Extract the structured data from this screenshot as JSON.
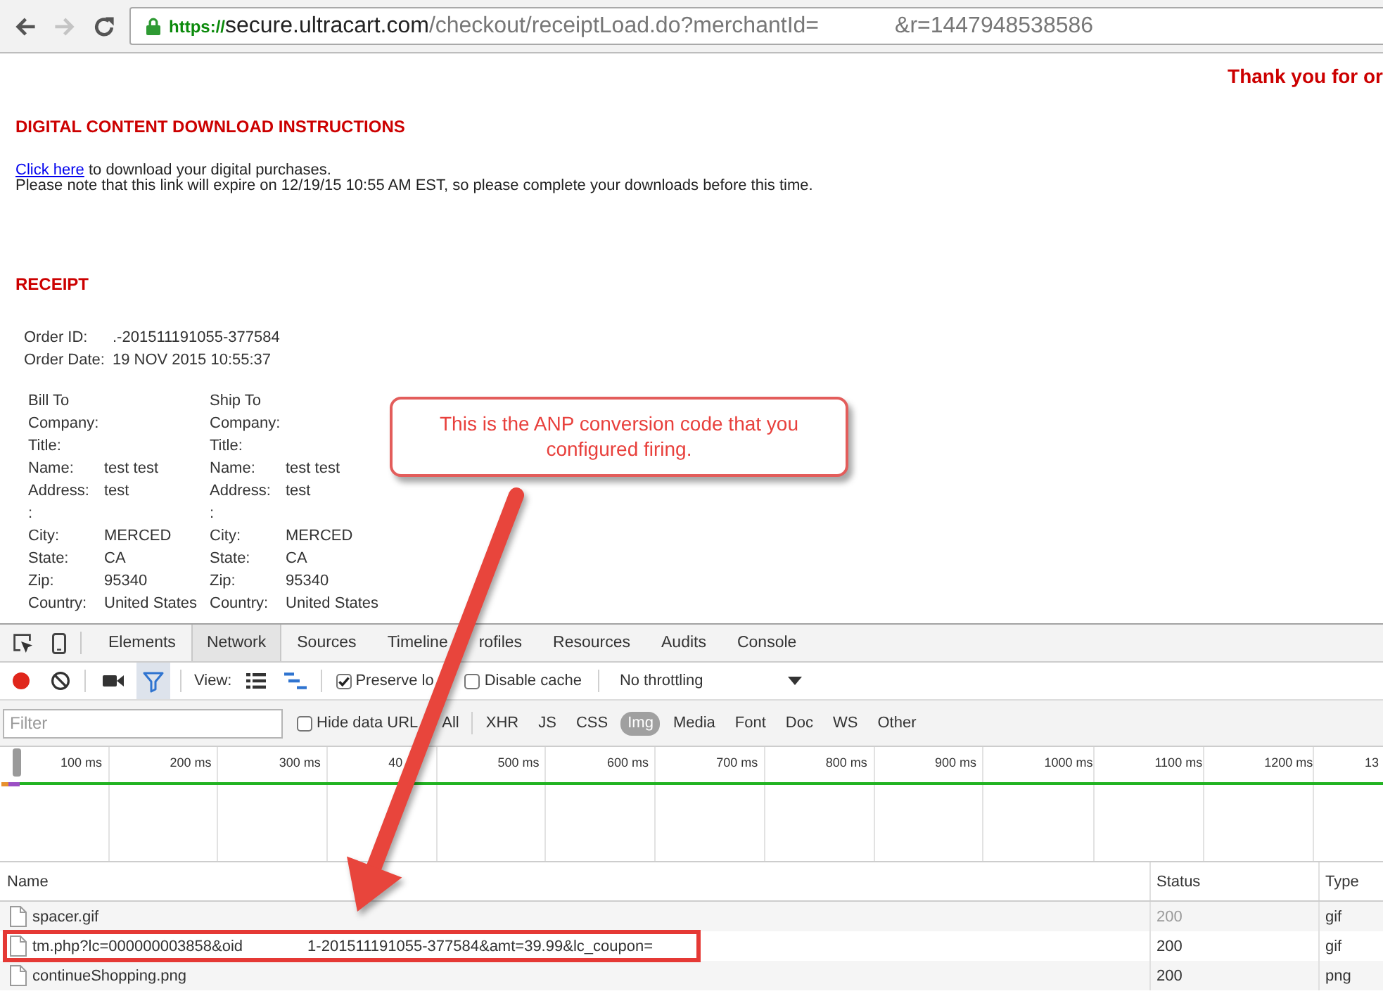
{
  "browser": {
    "nav_buttons": [
      {
        "kind": "back",
        "disabled": false
      },
      {
        "kind": "forward",
        "disabled": true
      },
      {
        "kind": "reload",
        "disabled": false
      }
    ],
    "address": {
      "secure": true,
      "scheme": "https://",
      "host": "secure.ultracart.com",
      "path": "/checkout/receiptLoad.do?merchantId=",
      "tail": "&r=1447948538586"
    }
  },
  "page": {
    "thank_you": "Thank you for or",
    "download": {
      "heading": "DIGITAL CONTENT DOWNLOAD INSTRUCTIONS",
      "link": "Click here",
      "link_rest": "to download your digital purchases.",
      "note": "Please note that this link will expire on 12/19/15 10:55 AM EST, so please complete your downloads before this time."
    },
    "receipt": {
      "heading": "RECEIPT",
      "order": [
        {
          "label": "Order ID:",
          "value": ".-201511191055-377584"
        },
        {
          "label": "Order Date:",
          "value": "19 NOV 2015 10:55:37"
        }
      ],
      "addresses": [
        {
          "heading": "Bill To",
          "fields": [
            {
              "label": "Company:"
            },
            {
              "label": "Title:"
            },
            {
              "label": "Name:",
              "value": "test test"
            },
            {
              "label": "Address:",
              "value": "test"
            },
            {
              "label": ":"
            },
            {
              "label": "City:",
              "value": "MERCED"
            },
            {
              "label": "State:",
              "value": "CA"
            },
            {
              "label": "Zip:",
              "value": "95340"
            },
            {
              "label": "Country:",
              "value": "United States"
            }
          ]
        },
        {
          "heading": "Ship To",
          "fields": [
            {
              "label": "Company:"
            },
            {
              "label": "Title:"
            },
            {
              "label": "Name:",
              "value": "test test"
            },
            {
              "label": "Address:",
              "value": "test"
            },
            {
              "label": ":"
            },
            {
              "label": "City:",
              "value": "MERCED"
            },
            {
              "label": "State:",
              "value": "CA"
            },
            {
              "label": "Zip:",
              "value": "95340"
            },
            {
              "label": "Country:",
              "value": "United States"
            }
          ]
        }
      ]
    }
  },
  "callout": {
    "text": "This is the ANP conversion code that you configured firing."
  },
  "devtools": {
    "tabs": [
      {
        "label": "Elements",
        "selected": false
      },
      {
        "label": "Network",
        "selected": true
      },
      {
        "label": "Sources",
        "selected": false
      },
      {
        "label": "Timeline",
        "selected": false
      },
      {
        "label": "rofiles",
        "selected": false
      },
      {
        "label": "Resources",
        "selected": false
      },
      {
        "label": "Audits",
        "selected": false
      },
      {
        "label": "Console",
        "selected": false
      }
    ],
    "toolbar": {
      "recording": true,
      "filter_on": true,
      "view_label": "View:",
      "large_rows": false,
      "overview_on": true,
      "checkboxes": [
        {
          "label": "Preserve lo",
          "checked": true
        },
        {
          "label": "Disable cache",
          "checked": false
        }
      ],
      "throttling": "No throttling"
    },
    "filter_bar": {
      "placeholder": "Filter",
      "hide_data_urls": {
        "label": "Hide data URL",
        "checked": false
      },
      "types": [
        {
          "label": "All",
          "selected": false
        },
        {
          "label": "XHR",
          "selected": false
        },
        {
          "label": "JS",
          "selected": false
        },
        {
          "label": "CSS",
          "selected": false
        },
        {
          "label": "Img",
          "selected": true
        },
        {
          "label": "Media",
          "selected": false
        },
        {
          "label": "Font",
          "selected": false
        },
        {
          "label": "Doc",
          "selected": false
        },
        {
          "label": "WS",
          "selected": false
        },
        {
          "label": "Other",
          "selected": false
        }
      ]
    },
    "overview": {
      "ticks": [
        "100 ms",
        "200 ms",
        "300 ms",
        "40",
        "500 ms",
        "600 ms",
        "700 ms",
        "800 ms",
        "900 ms",
        "1000 ms",
        "1100 ms",
        "1200 ms",
        "13"
      ]
    },
    "table": {
      "columns": [
        "Name",
        "Status",
        "Type"
      ],
      "rows": [
        {
          "name_parts": [
            "spacer.gif"
          ],
          "status": "200",
          "type": "gif",
          "cached": true,
          "highlighted": false
        },
        {
          "name_parts": [
            "tm.php?lc=000000003858&oid",
            "1-201511191055-377584&amt=39.99&lc_coupon="
          ],
          "status": "200",
          "type": "gif",
          "cached": false,
          "highlighted": true
        },
        {
          "name_parts": [
            "continueShopping.png"
          ],
          "status": "200",
          "type": "png",
          "cached": false,
          "highlighted": false
        }
      ]
    }
  }
}
